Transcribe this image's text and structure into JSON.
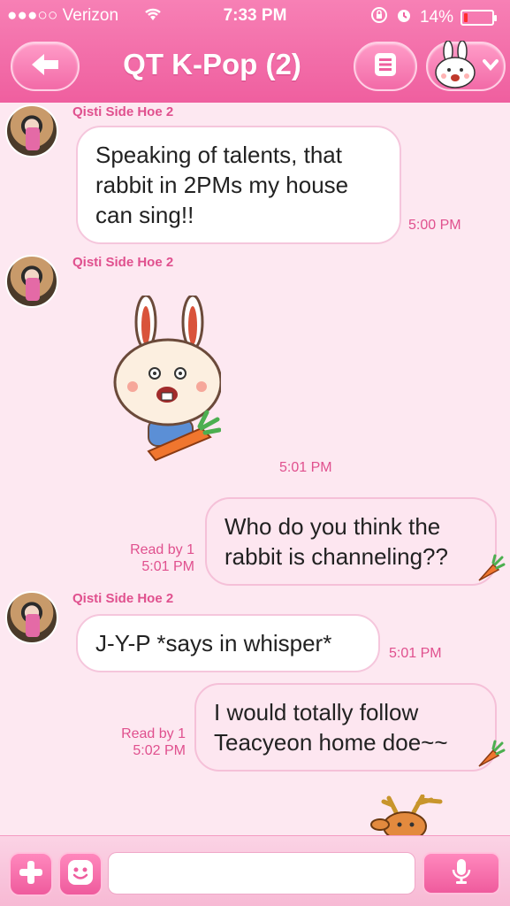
{
  "status_bar": {
    "carrier": "●●●○○ Verizon",
    "time": "7:33 PM",
    "battery": "14%",
    "battery_level": 0.14
  },
  "header": {
    "title": "QT K-Pop (2)",
    "back_icon": "back-arrow-icon",
    "menu_icon": "menu-list-icon",
    "sticker_icon": "rabbit-sticker-icon"
  },
  "messages": [
    {
      "sender": "Qisti Side Hoe 2",
      "type": "text",
      "lines": [
        "Speaking of talents, that",
        "rabbit in 2PMs my house",
        "can sing!!"
      ],
      "time": "5:00 PM"
    },
    {
      "sender": "Qisti Side Hoe 2",
      "type": "sticker",
      "sticker": "rabbit-with-carrot",
      "time": "5:01 PM"
    },
    {
      "sender": "me",
      "type": "text",
      "lines": [
        "Who do you think the",
        "rabbit is channeling??"
      ],
      "read_label": "Read by 1",
      "time": "5:01 PM"
    },
    {
      "sender": "Qisti Side Hoe 2",
      "type": "text",
      "lines": [
        "J-Y-P *says in whisper*"
      ],
      "time": "5:01 PM"
    },
    {
      "sender": "me",
      "type": "text",
      "lines": [
        "I would totally follow",
        "Teacyeon home doe~~"
      ],
      "read_label": "Read by 1",
      "time": "5:02 PM"
    }
  ],
  "input_bar": {
    "placeholder": "",
    "value": "",
    "plus_icon": "plus-icon",
    "emoji_icon": "emoji-face-icon",
    "mic_icon": "microphone-icon"
  },
  "colors": {
    "accent": "#ef5f9f",
    "background": "#fde8f1",
    "name_text": "#e0508e"
  }
}
